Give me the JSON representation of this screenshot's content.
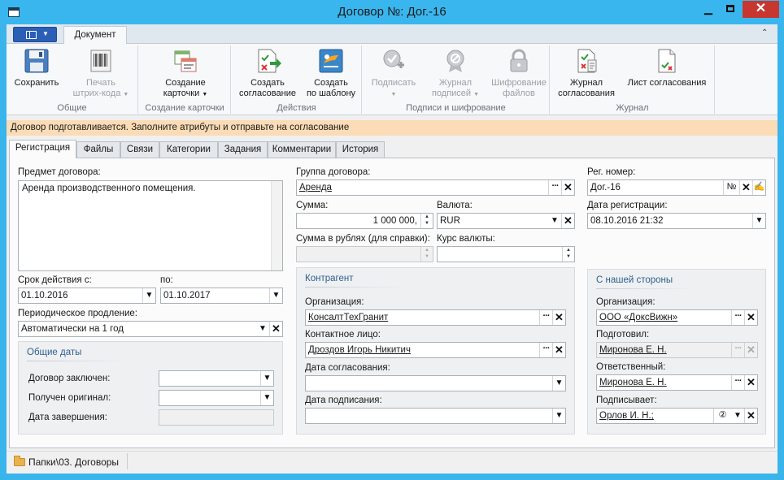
{
  "window": {
    "title": "Договор №: Дог.-16"
  },
  "ribbon": {
    "tab": "Документ",
    "groups": [
      {
        "label": "Общие",
        "buttons": [
          "Сохранить",
          "Печать\nштрих-кода"
        ]
      },
      {
        "label": "Создание карточки",
        "buttons": [
          "Создание\nкарточки"
        ]
      },
      {
        "label": "Действия",
        "buttons": [
          "Создать\nсогласование",
          "Создать\nпо шаблону"
        ]
      },
      {
        "label": "Подписи и шифрование",
        "buttons": [
          "Подписать",
          "Журнал\nподписей",
          "Шифрование\nфайлов"
        ]
      },
      {
        "label": "Журнал",
        "buttons": [
          "Журнал\nсогласования",
          "Лист согласования"
        ]
      }
    ]
  },
  "notice": "Договор подготавливается. Заполните атрибуты и отправьте на согласование",
  "tabs": [
    "Регистрация",
    "Файлы",
    "Связи",
    "Категории",
    "Задания",
    "Комментарии",
    "История"
  ],
  "form": {
    "subject_label": "Предмет договора:",
    "subject_value": "Аренда производственного помещения.",
    "valid_from_label": "Срок действия с:",
    "valid_from": "01.10.2016",
    "valid_to_label": "по:",
    "valid_to": "01.10.2017",
    "renewal_label": "Периодическое продление:",
    "renewal_value": "Автоматически на 1 год",
    "common_dates": {
      "title": "Общие даты",
      "concluded_label": "Договор заключен:",
      "original_label": "Получен оригинал:",
      "completion_label": "Дата завершения:"
    },
    "group_label": "Группа договора:",
    "group_value": "Аренда",
    "amount_label": "Сумма:",
    "amount_value": "1 000 000,",
    "currency_label": "Валюта:",
    "currency_value": "RUR",
    "rub_amount_label": "Сумма в рублях (для справки):",
    "rate_label": "Курс валюты:",
    "counterparty": {
      "title": "Контрагент",
      "org_label": "Организация:",
      "org_value": "КонсалтТехГранит",
      "contact_label": "Контактное лицо:",
      "contact_value": "Дроздов Игорь Никитич",
      "approval_date_label": "Дата согласования:",
      "sign_date_label": "Дата подписания:"
    },
    "reg_number_label": "Рег. номер:",
    "reg_number_value": "Дог.-16",
    "reg_number_sign": "№",
    "reg_date_label": "Дата регистрации:",
    "reg_date_value": "08.10.2016 21:32",
    "our_side": {
      "title": "С нашей стороны",
      "org_label": "Организация:",
      "org_value": "ООО «ДоксВижн»",
      "prepared_label": "Подготовил:",
      "prepared_value": "Миронова Е. Н.",
      "responsible_label": "Ответственный:",
      "responsible_value": "Миронова Е. Н.",
      "signer_label": "Подписывает:",
      "signer_value": "Орлов И. Н.;",
      "signer_count": "②"
    }
  },
  "statusbar": {
    "path": "Папки\\03. Договоры"
  },
  "colors": {
    "titlebar": "#39b5ec",
    "close": "#c7372f",
    "notice": "#fbdcb6",
    "app_button": "#2b5fb6"
  }
}
